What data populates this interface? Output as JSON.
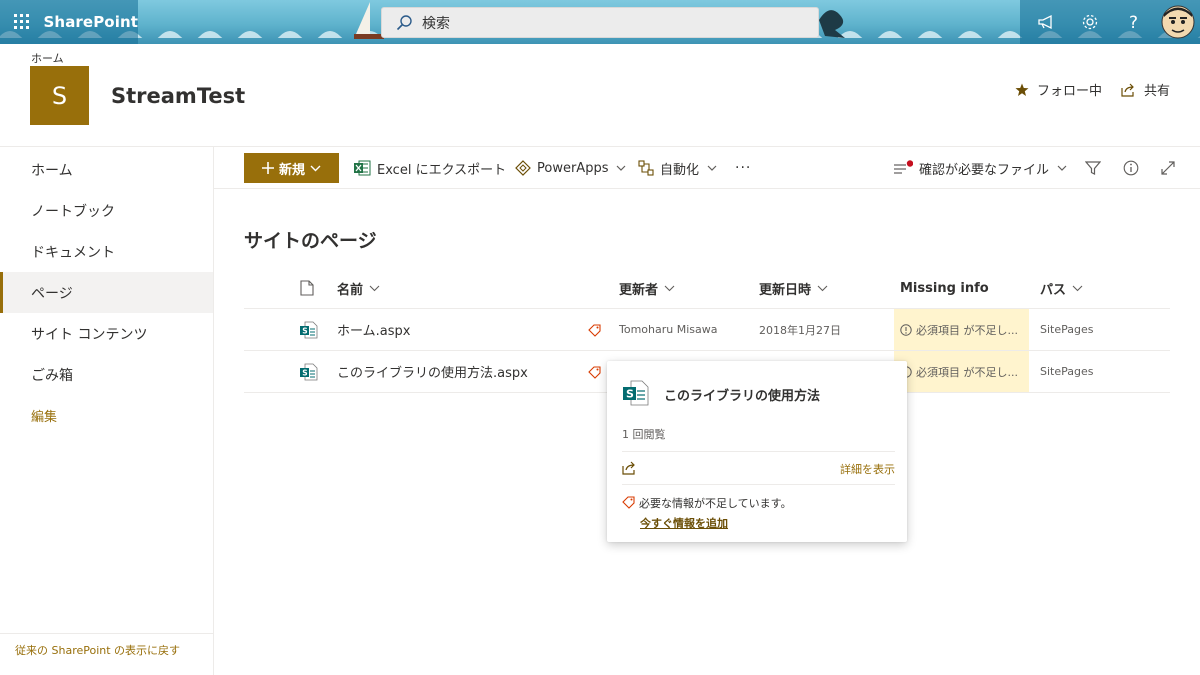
{
  "suite": {
    "brand": "SharePoint",
    "search_placeholder": "検索",
    "icons": [
      "megaphone-icon",
      "gear-icon",
      "help-icon"
    ]
  },
  "site": {
    "breadcrumb": "ホーム",
    "logo_letter": "S",
    "title": "StreamTest",
    "follow_label": "フォロー中",
    "share_label": "共有",
    "accent_color": "#986f0b"
  },
  "nav": {
    "items": [
      "ホーム",
      "ノートブック",
      "ドキュメント",
      "ページ",
      "サイト コンテンツ",
      "ごみ箱"
    ],
    "selected": "ページ",
    "edit_label": "編集",
    "classic_link": "従来の SharePoint の表示に戻す"
  },
  "commands": {
    "new_label": "新規",
    "export_label": "Excel にエクスポート",
    "powerapps_label": "PowerApps",
    "automate_label": "自動化",
    "more_label": "···",
    "view_label": "確認が必要なファイル"
  },
  "library": {
    "heading": "サイトのページ",
    "columns": {
      "name": "名前",
      "modified_by": "更新者",
      "modified": "更新日時",
      "missing": "Missing info",
      "path": "パス"
    },
    "rows": [
      {
        "name": "ホーム.aspx",
        "modified_by": "Tomoharu Misawa",
        "modified": "2018年1月27日",
        "missing": "必須項目 が不足し...",
        "path": "SitePages"
      },
      {
        "name": "このライブラリの使用方法.aspx",
        "modified_by": "",
        "modified": "",
        "missing": "必須項目 が不足し...",
        "path": "SitePages"
      }
    ]
  },
  "hovercard": {
    "title": "このライブラリの使用方法",
    "views": "1 回閲覧",
    "details_link": "詳細を表示",
    "message": "必要な情報が不足しています。",
    "add_link": "今すぐ情報を追加"
  }
}
